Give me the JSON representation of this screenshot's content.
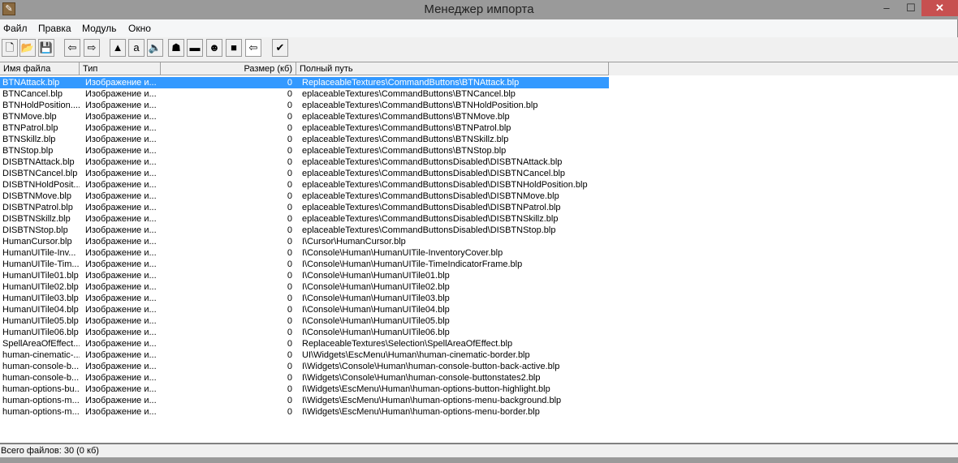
{
  "window": {
    "title": "Менеджер импорта",
    "minimize": "–",
    "maximize": "☐",
    "close": "✕"
  },
  "menu": [
    "Файл",
    "Правка",
    "Модуль",
    "Окно"
  ],
  "toolbar": [
    {
      "name": "new-file",
      "glyph": "🗋"
    },
    {
      "name": "open-folder",
      "glyph": "📂"
    },
    {
      "name": "save",
      "glyph": "💾"
    },
    {
      "name": "import-file",
      "glyph": "⇦"
    },
    {
      "name": "export-file",
      "glyph": "⇨"
    },
    {
      "name": "terrain",
      "glyph": "▲"
    },
    {
      "name": "text",
      "glyph": "a"
    },
    {
      "name": "sound",
      "glyph": "🔈"
    },
    {
      "name": "unit",
      "glyph": "☗"
    },
    {
      "name": "item",
      "glyph": "▬"
    },
    {
      "name": "ai",
      "glyph": "☻"
    },
    {
      "name": "object",
      "glyph": "■"
    },
    {
      "name": "import-manager",
      "glyph": "⇦"
    },
    {
      "name": "test-map",
      "glyph": "✔"
    }
  ],
  "columns": [
    "Имя файла",
    "Тип",
    "Размер (кб)",
    "Полный путь"
  ],
  "rows": [
    [
      "BTNAttack.blp",
      "Изображение и...",
      "0",
      "ReplaceableTextures\\CommandButtons\\BTNAttack.blp"
    ],
    [
      "BTNCancel.blp",
      "Изображение и...",
      "0",
      "eplaceableTextures\\CommandButtons\\BTNCancel.blp"
    ],
    [
      "BTNHoldPosition....",
      "Изображение и...",
      "0",
      "eplaceableTextures\\CommandButtons\\BTNHoldPosition.blp"
    ],
    [
      "BTNMove.blp",
      "Изображение и...",
      "0",
      "eplaceableTextures\\CommandButtons\\BTNMove.blp"
    ],
    [
      "BTNPatrol.blp",
      "Изображение и...",
      "0",
      "eplaceableTextures\\CommandButtons\\BTNPatrol.blp"
    ],
    [
      "BTNSkillz.blp",
      "Изображение и...",
      "0",
      "eplaceableTextures\\CommandButtons\\BTNSkillz.blp"
    ],
    [
      "BTNStop.blp",
      "Изображение и...",
      "0",
      "eplaceableTextures\\CommandButtons\\BTNStop.blp"
    ],
    [
      "DISBTNAttack.blp",
      "Изображение и...",
      "0",
      "eplaceableTextures\\CommandButtonsDisabled\\DISBTNAttack.blp"
    ],
    [
      "DISBTNCancel.blp",
      "Изображение и...",
      "0",
      "eplaceableTextures\\CommandButtonsDisabled\\DISBTNCancel.blp"
    ],
    [
      "DISBTNHoldPosit...",
      "Изображение и...",
      "0",
      "eplaceableTextures\\CommandButtonsDisabled\\DISBTNHoldPosition.blp"
    ],
    [
      "DISBTNMove.blp",
      "Изображение и...",
      "0",
      "eplaceableTextures\\CommandButtonsDisabled\\DISBTNMove.blp"
    ],
    [
      "DISBTNPatrol.blp",
      "Изображение и...",
      "0",
      "eplaceableTextures\\CommandButtonsDisabled\\DISBTNPatrol.blp"
    ],
    [
      "DISBTNSkillz.blp",
      "Изображение и...",
      "0",
      "eplaceableTextures\\CommandButtonsDisabled\\DISBTNSkillz.blp"
    ],
    [
      "DISBTNStop.blp",
      "Изображение и...",
      "0",
      "eplaceableTextures\\CommandButtonsDisabled\\DISBTNStop.blp"
    ],
    [
      "HumanCursor.blp",
      "Изображение и...",
      "0",
      "I\\Cursor\\HumanCursor.blp"
    ],
    [
      "HumanUITile-Inv...",
      "Изображение и...",
      "0",
      "I\\Console\\Human\\HumanUITile-InventoryCover.blp"
    ],
    [
      "HumanUITile-Tim...",
      "Изображение и...",
      "0",
      "I\\Console\\Human\\HumanUITile-TimeIndicatorFrame.blp"
    ],
    [
      "HumanUITile01.blp",
      "Изображение и...",
      "0",
      "I\\Console\\Human\\HumanUITile01.blp"
    ],
    [
      "HumanUITile02.blp",
      "Изображение и...",
      "0",
      "I\\Console\\Human\\HumanUITile02.blp"
    ],
    [
      "HumanUITile03.blp",
      "Изображение и...",
      "0",
      "I\\Console\\Human\\HumanUITile03.blp"
    ],
    [
      "HumanUITile04.blp",
      "Изображение и...",
      "0",
      "I\\Console\\Human\\HumanUITile04.blp"
    ],
    [
      "HumanUITile05.blp",
      "Изображение и...",
      "0",
      "I\\Console\\Human\\HumanUITile05.blp"
    ],
    [
      "HumanUITile06.blp",
      "Изображение и...",
      "0",
      "I\\Console\\Human\\HumanUITile06.blp"
    ],
    [
      "SpellAreaOfEffect...",
      "Изображение и...",
      "0",
      "ReplaceableTextures\\Selection\\SpellAreaOfEffect.blp"
    ],
    [
      "human-cinematic-...",
      "Изображение и...",
      "0",
      "UI\\Widgets\\EscMenu\\Human\\human-cinematic-border.blp"
    ],
    [
      "human-console-b...",
      "Изображение и...",
      "0",
      "I\\Widgets\\Console\\Human\\human-console-button-back-active.blp"
    ],
    [
      "human-console-b...",
      "Изображение и...",
      "0",
      "I\\Widgets\\Console\\Human\\human-console-buttonstates2.blp"
    ],
    [
      "human-options-bu...",
      "Изображение и...",
      "0",
      "I\\Widgets\\EscMenu\\Human\\human-options-button-highlight.blp"
    ],
    [
      "human-options-m...",
      "Изображение и...",
      "0",
      "I\\Widgets\\EscMenu\\Human\\human-options-menu-background.blp"
    ],
    [
      "human-options-m...",
      "Изображение и...",
      "0",
      "I\\Widgets\\EscMenu\\Human\\human-options-menu-border.blp"
    ]
  ],
  "selected_row": 0,
  "status": "Всего файлов: 30 (0 кб)"
}
